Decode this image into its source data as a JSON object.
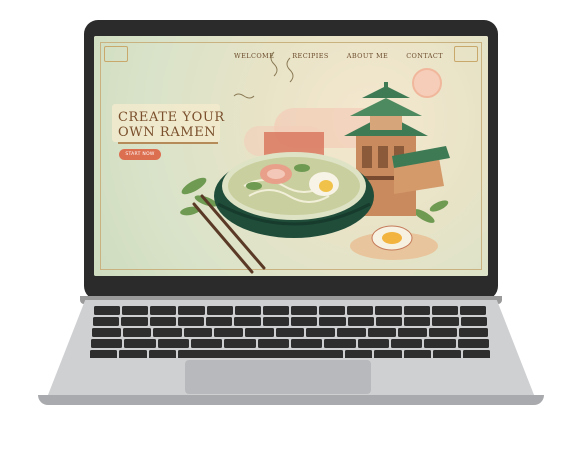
{
  "nav": {
    "items": [
      "WELCOME",
      "RECIPIES",
      "ABOUT ME",
      "CONTACT"
    ]
  },
  "hero": {
    "title_line1": "CREATE YOUR",
    "title_line2": "OWN RAMEN",
    "cta_label": "START NOW"
  },
  "colors": {
    "accent": "#dd6f51",
    "title": "#7a4f2c",
    "bowl": "#1f4d3a"
  }
}
